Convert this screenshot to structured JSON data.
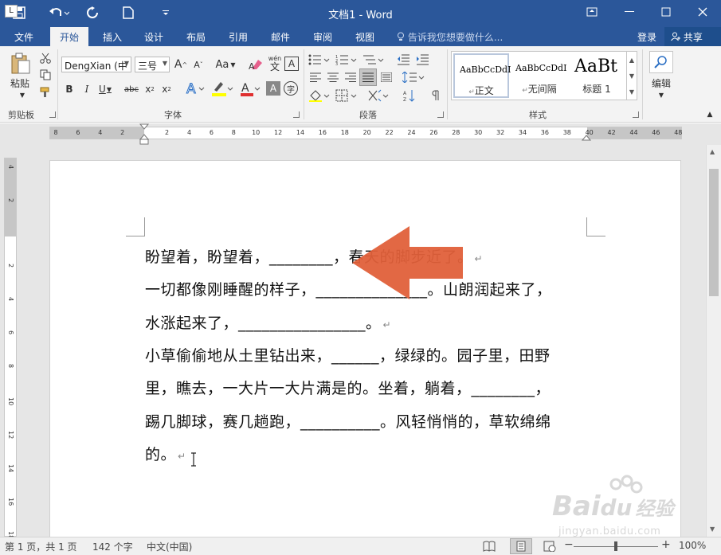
{
  "window": {
    "title": "文档1 - Word"
  },
  "colors": {
    "accent": "#2b579a",
    "arrow": "#e0603a"
  },
  "tabs": {
    "file": "文件",
    "home": "开始",
    "insert": "插入",
    "design": "设计",
    "layout": "布局",
    "references": "引用",
    "mailings": "邮件",
    "review": "审阅",
    "view": "视图"
  },
  "tell_me": "告诉我您想要做什么...",
  "account": {
    "signin": "登录",
    "share": "共享"
  },
  "clipboard": {
    "paste": "粘贴",
    "label": "剪贴板"
  },
  "font": {
    "name": "DengXian (中",
    "size": "三号",
    "label": "字体",
    "grow": "A",
    "shrink": "A",
    "case": "Aa",
    "bold": "B",
    "italic": "I",
    "underline": "U",
    "strike": "abc",
    "subscript": "x",
    "superscript": "x",
    "color_a": "A",
    "phonetic": "wén",
    "phonetic_char": "文",
    "border_char": "A"
  },
  "paragraph": {
    "label": "段落"
  },
  "styles": {
    "label": "样式",
    "items": [
      {
        "sample": "AaBbCcDdI",
        "name": "正文"
      },
      {
        "sample": "AaBbCcDdI",
        "name": "无间隔"
      },
      {
        "sample": "AaBt",
        "name": "标题 1"
      }
    ]
  },
  "editing": {
    "label": "编辑"
  },
  "ruler": {
    "h_ticks": [
      "8",
      "6",
      "4",
      "2",
      "2",
      "4",
      "6",
      "8",
      "10",
      "12",
      "14",
      "16",
      "18",
      "20",
      "22",
      "24",
      "26",
      "28",
      "30",
      "32",
      "34",
      "36",
      "38",
      "40",
      "42",
      "44",
      "46",
      "48"
    ],
    "v_ticks": [
      "4",
      "2",
      "2",
      "4",
      "6",
      "8",
      "10",
      "12",
      "14",
      "16",
      "18"
    ]
  },
  "document": {
    "lines": [
      {
        "text": "盼望着，盼望着，________，春天的脚步近了。",
        "mark": "↵"
      },
      {
        "text": "一切都像刚睡醒的样子，______________。山朗润起来了，",
        "mark": ""
      },
      {
        "text": "水涨起来了，________________。",
        "mark": "↵"
      },
      {
        "text": "小草偷偷地从土里钻出来，______，绿绿的。园子里，田野",
        "mark": ""
      },
      {
        "text": "里，瞧去，一大片一大片满是的。坐着，躺着，________，",
        "mark": ""
      },
      {
        "text": "踢几脚球，赛几趟跑，__________。风轻悄悄的，草软绵绵",
        "mark": ""
      },
      {
        "text": "的。",
        "mark": "↵"
      }
    ]
  },
  "status": {
    "page": "第 1 页，共 1 页",
    "words": "142 个字",
    "language": "中文(中国)",
    "zoom": "100%",
    "minus": "−",
    "plus": "+"
  },
  "watermark": {
    "brand": "Bai",
    "brand2": "经验",
    "url": "jingyan.baidu.com"
  }
}
